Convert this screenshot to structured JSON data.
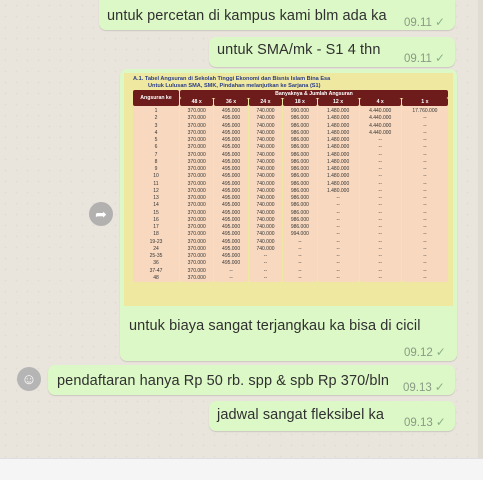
{
  "messages": [
    {
      "text": "untuk percetan di kampus kami blm ada ka",
      "time": "09.11"
    },
    {
      "text": "untuk SMA/mk - S1 4 thn",
      "time": "09.11"
    },
    {
      "text": "untuk biaya sangat terjangkau ka bisa di cicil",
      "time": "09.12"
    },
    {
      "text": "pendaftaran hanya Rp 50 rb. spp & spb Rp 370/bln",
      "time": "09.13"
    },
    {
      "text": "jadwal sangat fleksibel ka",
      "time": "09.13"
    }
  ],
  "document": {
    "title": "A.1.   Tabel Angsuran di Sekolah Tinggi Ekonomi dan Bisnis Islam Bina Esa",
    "subtitle": "Untuk Lulusan SMA, SMK, Pindahan melanjutkan ke Sarjana (S1)",
    "col_first": "Angsuran ke",
    "col_group": "Banyaknya & Jumlah Angsuran",
    "cols": [
      "48 x",
      "36 x",
      "24 x",
      "18 x",
      "12 x",
      "4 x",
      "1 x"
    ],
    "rows": [
      [
        "1",
        "370.000",
        "495.000",
        "740.000",
        "990.000",
        "1.480.000",
        "4.440.000",
        "17.760.000"
      ],
      [
        "2",
        "370.000",
        "495.000",
        "740.000",
        "986.000",
        "1.480.000",
        "4.440.000",
        "--"
      ],
      [
        "3",
        "370.000",
        "495.000",
        "740.000",
        "986.000",
        "1.480.000",
        "4.440.000",
        "--"
      ],
      [
        "4",
        "370.000",
        "495.000",
        "740.000",
        "986.000",
        "1.480.000",
        "4.440.000",
        "--"
      ],
      [
        "5",
        "370.000",
        "495.000",
        "740.000",
        "986.000",
        "1.480.000",
        "--",
        "--"
      ],
      [
        "6",
        "370.000",
        "495.000",
        "740.000",
        "986.000",
        "1.480.000",
        "--",
        "--"
      ],
      [
        "7",
        "370.000",
        "495.000",
        "740.000",
        "986.000",
        "1.480.000",
        "--",
        "--"
      ],
      [
        "8",
        "370.000",
        "495.000",
        "740.000",
        "986.000",
        "1.480.000",
        "--",
        "--"
      ],
      [
        "9",
        "370.000",
        "495.000",
        "740.000",
        "986.000",
        "1.480.000",
        "--",
        "--"
      ],
      [
        "10",
        "370.000",
        "495.000",
        "740.000",
        "986.000",
        "1.480.000",
        "--",
        "--"
      ],
      [
        "11",
        "370.000",
        "495.000",
        "740.000",
        "986.000",
        "1.480.000",
        "--",
        "--"
      ],
      [
        "12",
        "370.000",
        "495.000",
        "740.000",
        "986.000",
        "1.480.000",
        "--",
        "--"
      ],
      [
        "13",
        "370.000",
        "495.000",
        "740.000",
        "986.000",
        "--",
        "--",
        "--"
      ],
      [
        "14",
        "370.000",
        "495.000",
        "740.000",
        "986.000",
        "--",
        "--",
        "--"
      ],
      [
        "15",
        "370.000",
        "495.000",
        "740.000",
        "986.000",
        "--",
        "--",
        "--"
      ],
      [
        "16",
        "370.000",
        "495.000",
        "740.000",
        "986.000",
        "--",
        "--",
        "--"
      ],
      [
        "17",
        "370.000",
        "495.000",
        "740.000",
        "986.000",
        "--",
        "--",
        "--"
      ],
      [
        "18",
        "370.000",
        "495.000",
        "740.000",
        "994.000",
        "--",
        "--",
        "--"
      ],
      [
        "19-23",
        "370.000",
        "495.000",
        "740.000",
        "--",
        "--",
        "--",
        "--"
      ],
      [
        "24",
        "370.000",
        "495.000",
        "740.000",
        "--",
        "--",
        "--",
        "--"
      ],
      [
        "25-35",
        "370.000",
        "495.000",
        "--",
        "--",
        "--",
        "--",
        "--"
      ],
      [
        "36",
        "370.000",
        "495.000",
        "--",
        "--",
        "--",
        "--",
        "--"
      ],
      [
        "37-47",
        "370.000",
        "--",
        "--",
        "--",
        "--",
        "--",
        "--"
      ],
      [
        "48",
        "370.000",
        "--",
        "--",
        "--",
        "--",
        "--",
        "--"
      ]
    ]
  },
  "icons": {
    "forward": "forward-icon",
    "emoji": "emoji-icon",
    "check": "check-icon"
  },
  "colors": {
    "bubble": "#dcf8c6",
    "table_header": "#6e1b1b",
    "table_cell": "#f8d9c0",
    "doc_bg": "#efe8a0"
  }
}
